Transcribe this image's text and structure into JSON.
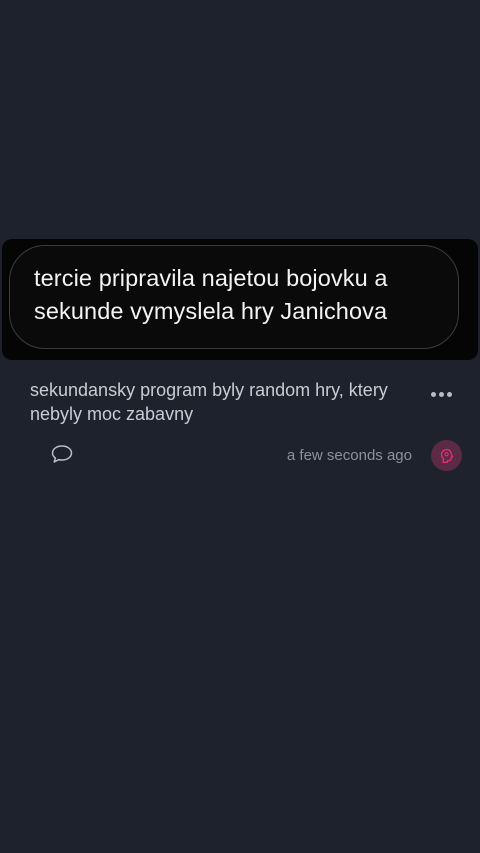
{
  "post": {
    "quote": "tercie pripravila najetou bojovku a sekunde vymyslela hry Janichova",
    "comment": "sekundansky program byly random hry, ktery nebyly moc zabavny",
    "timestamp": "a few seconds ago"
  },
  "icons": {
    "more": "more-horizontal-icon",
    "reply": "speech-bubble-icon",
    "avatar": "user-avatar-icon"
  },
  "colors": {
    "background": "#1d222d",
    "quote_panel": "#050506",
    "accent": "#e0307a"
  }
}
